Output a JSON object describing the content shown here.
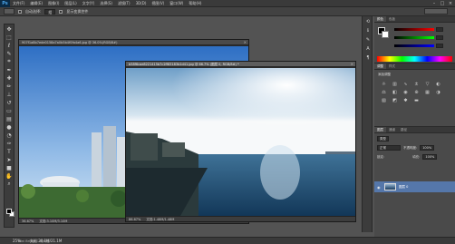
{
  "app": {
    "logo": "Ps"
  },
  "menu": [
    "文件(F)",
    "编辑(E)",
    "图像(I)",
    "图层(L)",
    "文字(Y)",
    "选择(S)",
    "滤镜(T)",
    "3D(D)",
    "视图(V)",
    "窗口(W)",
    "帮助(H)"
  ],
  "options": {
    "auto_select_label": "自动选择:",
    "auto_select_value": "组",
    "transform_label": "显示变换控件"
  },
  "doc_back": {
    "title": "907f1a8b7ede0158a7a0b5b4f0fa4a6.jpg @ 36.0%(RGB/8#)",
    "zoom": "36.67%",
    "info": "文档:3.10M/3.10M"
  },
  "doc_front": {
    "title": "b58f6cae8221415b7c2ff83183b1d41.jpg @ 66.7% (图层 0, RGB/8#) *",
    "zoom": "86.67%",
    "info": "文档:1.48M/1.48M"
  },
  "statusbar": {
    "zoom": "25%",
    "info": "文档:20.1M/21.1M"
  },
  "bottom_tabs": [
    "Mini Bridge",
    "时间轴"
  ],
  "panels": {
    "color_tabs": [
      "颜色",
      "色板"
    ],
    "adj_tabs": [
      "调整",
      "样式"
    ],
    "adj_title": "添加调整",
    "layers_tabs": [
      "图层",
      "通道",
      "路径"
    ],
    "kind_label": "类型",
    "blend_mode": "正常",
    "opacity_label": "不透明度:",
    "opacity_value": "100%",
    "lock_label": "锁定:",
    "fill_label": "填充:",
    "fill_value": "100%",
    "layer_name": "图层 0"
  },
  "colors": {
    "accent": "#5577aa",
    "bg": "#535353"
  }
}
